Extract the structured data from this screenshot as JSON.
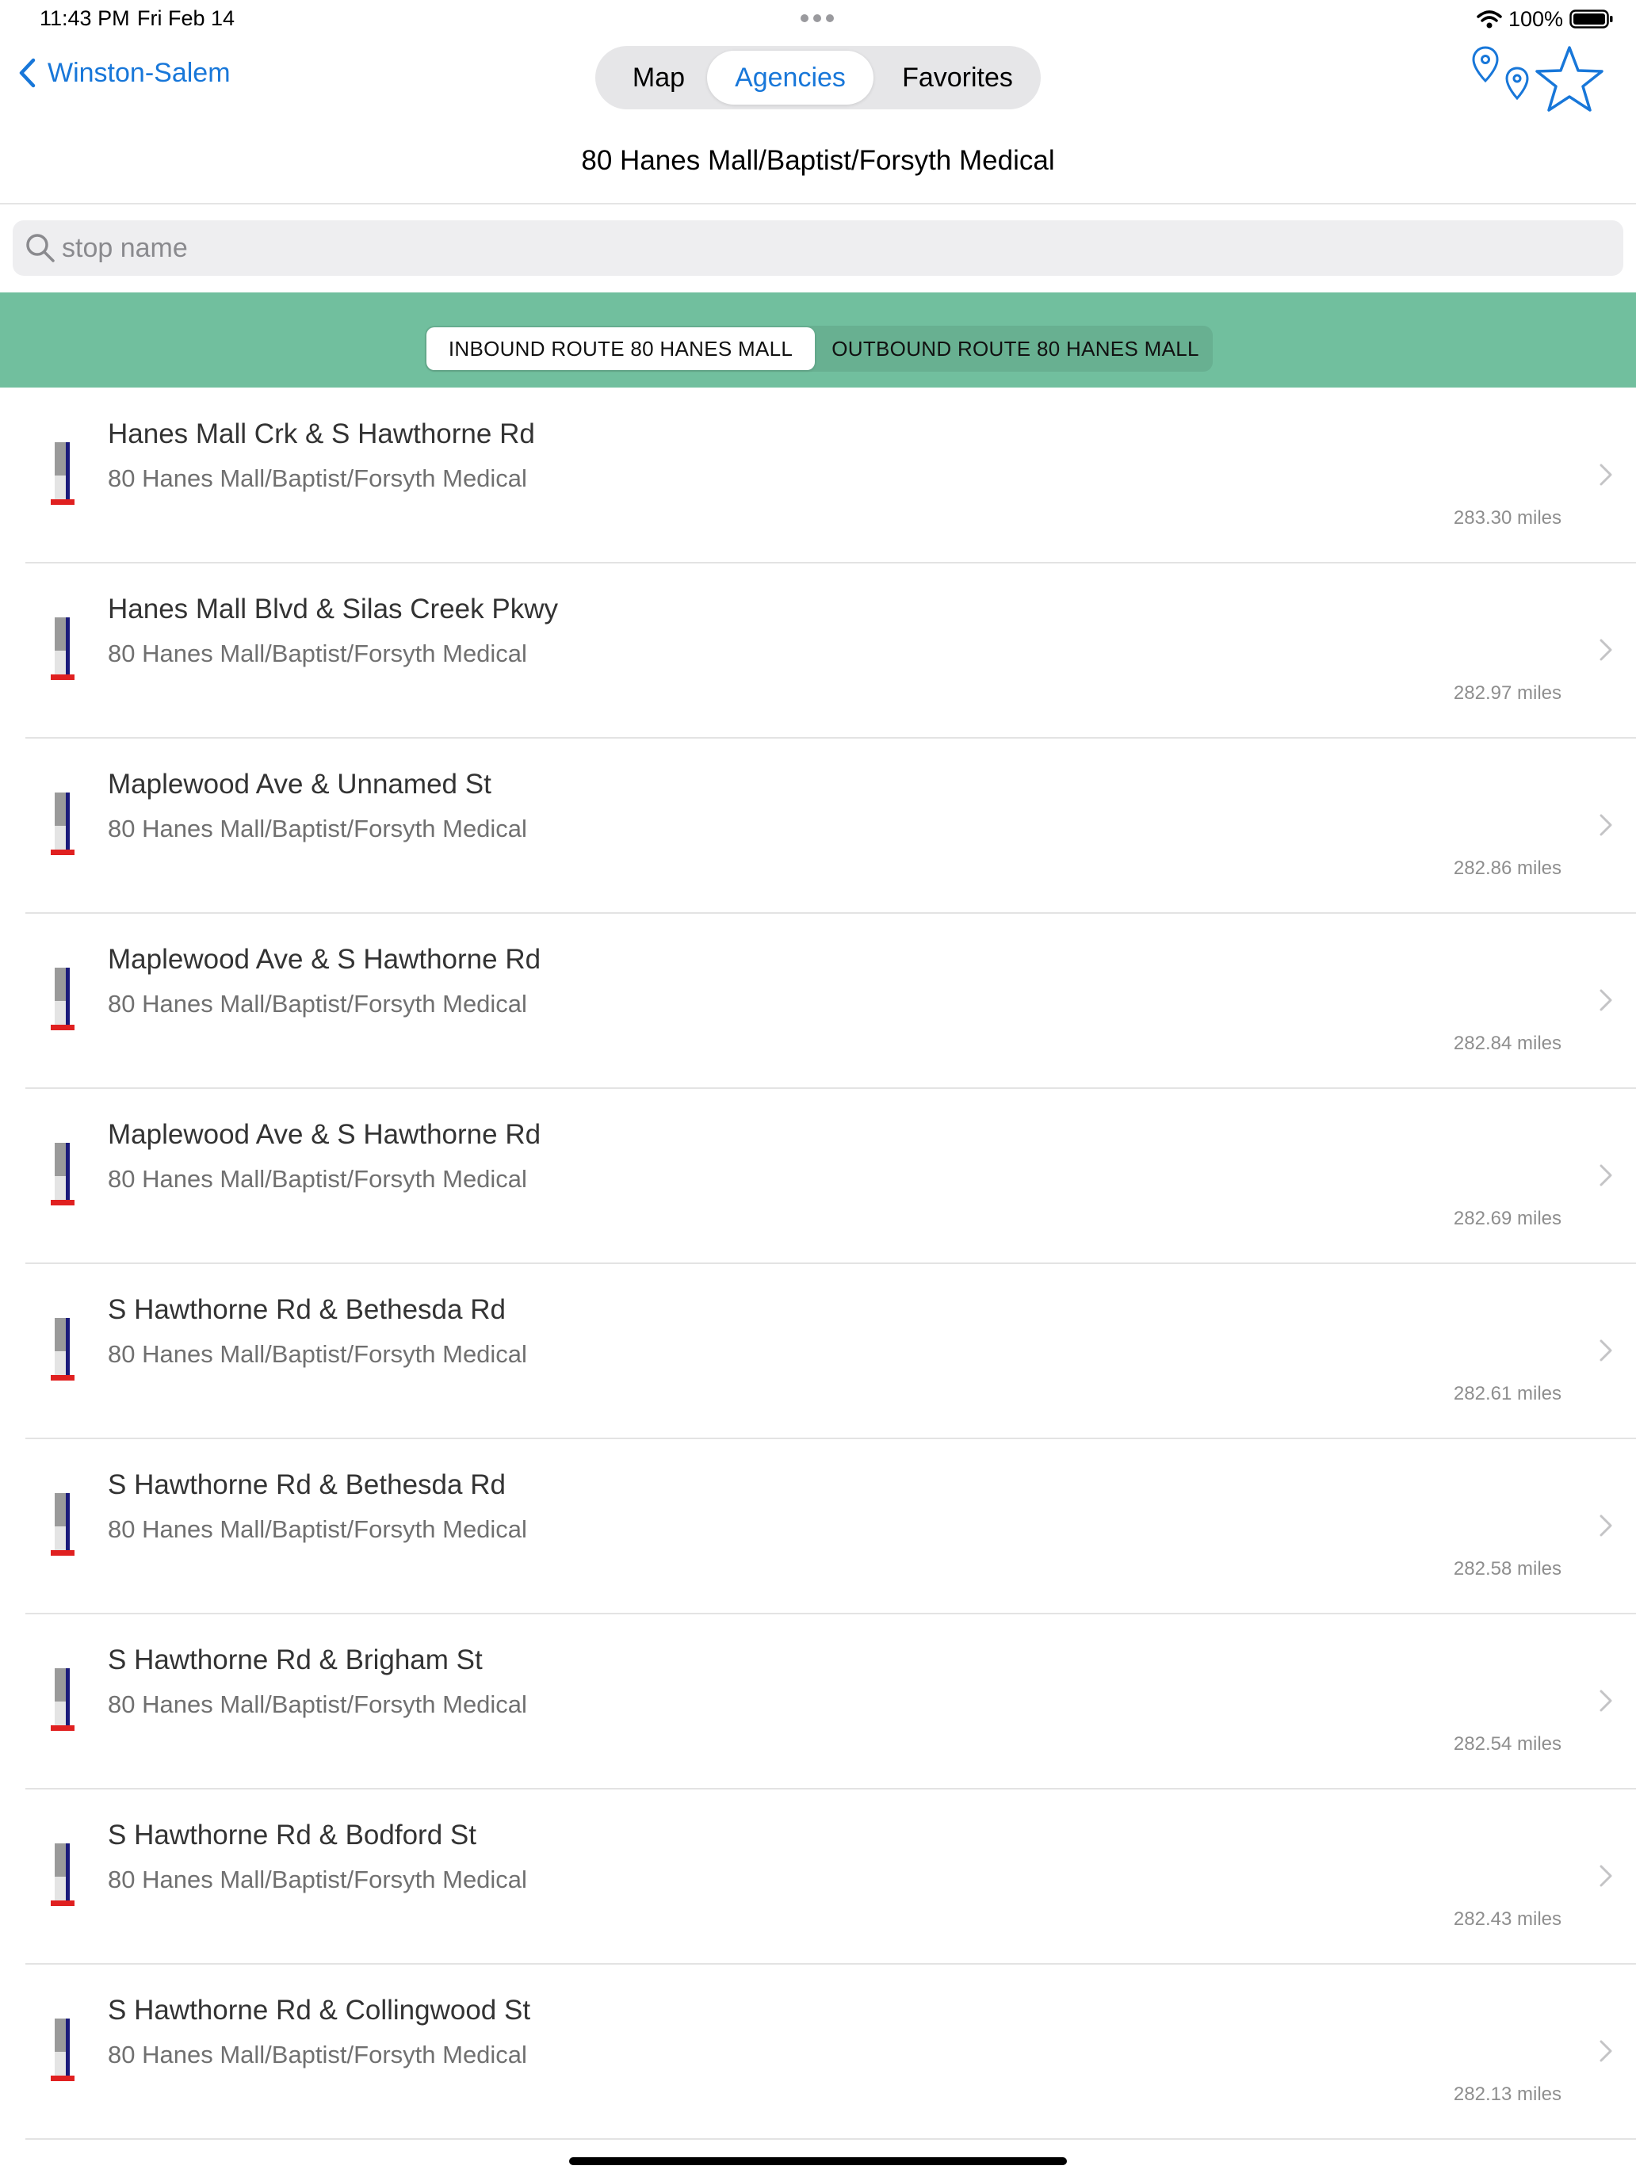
{
  "status_bar": {
    "time": "11:43 PM",
    "date": "Fri Feb 14",
    "battery": "100%"
  },
  "nav": {
    "back_label": "Winston-Salem",
    "segments": {
      "map": "Map",
      "agencies": "Agencies",
      "favorites": "Favorites"
    },
    "selected_segment": "Agencies",
    "icons": [
      "map-pin-icon",
      "map-pin-icon",
      "star-icon"
    ]
  },
  "page_title": "80 Hanes Mall/Baptist/Forsyth Medical",
  "search": {
    "placeholder": "stop name",
    "value": ""
  },
  "direction": {
    "inbound": "INBOUND ROUTE 80 HANES MALL",
    "outbound": "OUTBOUND ROUTE 80 HANES MALL",
    "selected": "inbound"
  },
  "colors": {
    "accent": "#1877d9",
    "band": "#71bf9e",
    "stop_icon_dark": "#1a1a7a",
    "stop_icon_red": "#e02020"
  },
  "stops": [
    {
      "name": "Hanes Mall Crk & S Hawthorne Rd",
      "route": "80 Hanes Mall/Baptist/Forsyth Medical",
      "distance": "283.30 miles"
    },
    {
      "name": "Hanes Mall Blvd & Silas Creek Pkwy",
      "route": "80 Hanes Mall/Baptist/Forsyth Medical",
      "distance": "282.97 miles"
    },
    {
      "name": "Maplewood Ave & Unnamed St",
      "route": "80 Hanes Mall/Baptist/Forsyth Medical",
      "distance": "282.86 miles"
    },
    {
      "name": "Maplewood Ave & S Hawthorne Rd",
      "route": "80 Hanes Mall/Baptist/Forsyth Medical",
      "distance": "282.84 miles"
    },
    {
      "name": "Maplewood Ave & S Hawthorne Rd",
      "route": "80 Hanes Mall/Baptist/Forsyth Medical",
      "distance": "282.69 miles"
    },
    {
      "name": "S Hawthorne Rd & Bethesda Rd",
      "route": "80 Hanes Mall/Baptist/Forsyth Medical",
      "distance": "282.61 miles"
    },
    {
      "name": "S Hawthorne Rd & Bethesda Rd",
      "route": "80 Hanes Mall/Baptist/Forsyth Medical",
      "distance": "282.58 miles"
    },
    {
      "name": "S Hawthorne Rd & Brigham St",
      "route": "80 Hanes Mall/Baptist/Forsyth Medical",
      "distance": "282.54 miles"
    },
    {
      "name": "S Hawthorne Rd & Bodford St",
      "route": "80 Hanes Mall/Baptist/Forsyth Medical",
      "distance": "282.43 miles"
    },
    {
      "name": "S Hawthorne Rd & Collingwood St",
      "route": "80 Hanes Mall/Baptist/Forsyth Medical",
      "distance": "282.13 miles"
    }
  ]
}
